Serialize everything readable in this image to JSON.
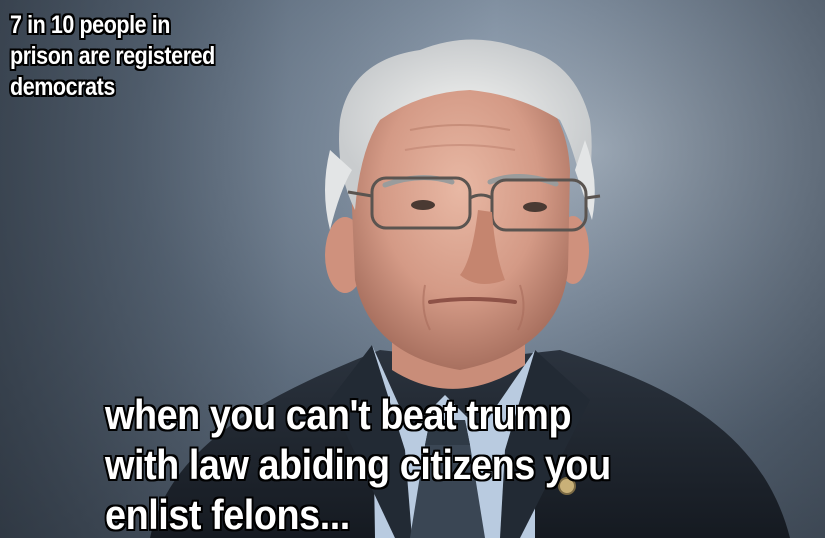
{
  "meme": {
    "top_text": "7 in 10 people in\nprison are registered\ndemocrats",
    "bottom_text": "when you can't beat trump\nwith law abiding citizens you\nenlist felons..."
  },
  "colors": {
    "background": "#6f7f90",
    "suit": "#1f2630",
    "shirt": "#b9cbe0",
    "caption_fill": "#ffffff",
    "caption_outline": "#000000"
  }
}
